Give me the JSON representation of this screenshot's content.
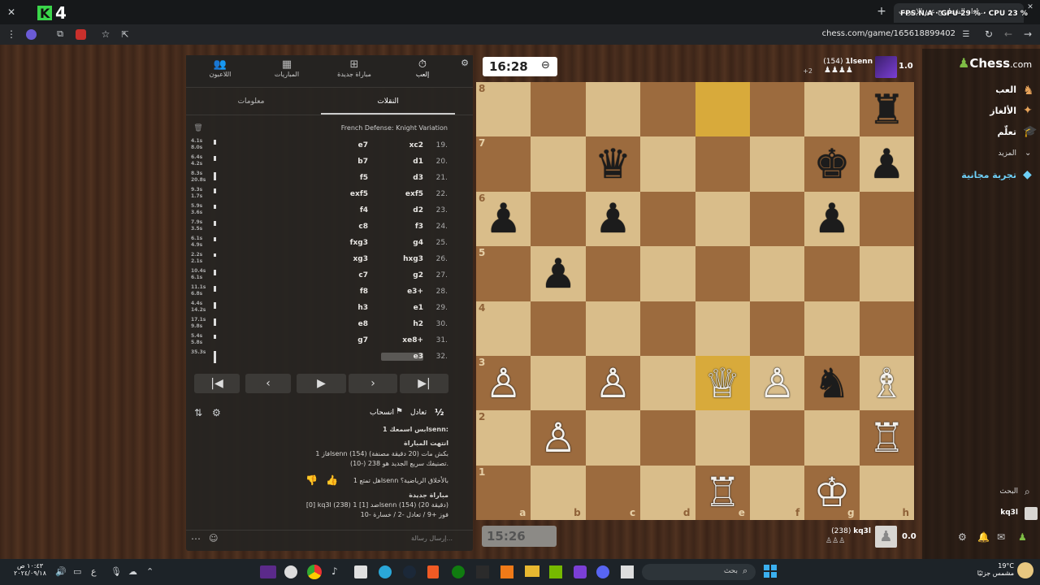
{
  "browser": {
    "close_label": "✕",
    "tab_title": "أداء الشطرنج عبر الإنترنت...",
    "fps_overlay": "FPS N/A · GPU 29 % · CPU 23 %",
    "url": "chess.com/game/165618899402",
    "new_tab": "+",
    "window_close": "✕"
  },
  "header_tabs": [
    {
      "label": "اللاعبون"
    },
    {
      "label": "المباريات"
    },
    {
      "label": "مباراة جديدة"
    },
    {
      "label": "إلعب"
    }
  ],
  "subtabs": {
    "info": "معلومات",
    "moves": "النقلات"
  },
  "opening": "French Defense: Knight Variation",
  "moves": [
    {
      "num": "19.",
      "white": "xc2",
      "black": "e7",
      "eval": "4.1s",
      "eval2": "8.0s",
      "fill": 0.3
    },
    {
      "num": "20.",
      "white": "d1",
      "black": "b7",
      "eval": "6.4s",
      "eval2": "4.2s",
      "fill": 0.25
    },
    {
      "num": "21.",
      "white": "d3",
      "black": "f5",
      "eval": "8.3s",
      "eval2": "20.8s",
      "fill": 0.6
    },
    {
      "num": "22.",
      "white": "exf5",
      "black": "exf5",
      "eval": "9.3s",
      "eval2": "1.7s",
      "fill": 0.3
    },
    {
      "num": "23.",
      "white": "d2",
      "black": "f4",
      "eval": "5.9s",
      "eval2": "3.6s",
      "fill": 0.2
    },
    {
      "num": "24.",
      "white": "f3",
      "black": "c8",
      "eval": "7.9s",
      "eval2": "3.5s",
      "fill": 0.25
    },
    {
      "num": "25.",
      "white": "g4",
      "black": "fxg3",
      "eval": "6.1s",
      "eval2": "4.9s",
      "fill": 0.2
    },
    {
      "num": "26.",
      "white": "hxg3",
      "black": "xg3",
      "eval": "2.2s",
      "eval2": "2.1s",
      "fill": 0.15
    },
    {
      "num": "27.",
      "white": "g2",
      "black": "c7",
      "eval": "10.4s",
      "eval2": "6.1s",
      "fill": 0.35
    },
    {
      "num": "28.",
      "white": "e3+",
      "black": "f8",
      "eval": "11.1s",
      "eval2": "6.8s",
      "fill": 0.35
    },
    {
      "num": "29.",
      "white": "e1",
      "black": "h3",
      "eval": "4.4s",
      "eval2": "14.2s",
      "fill": 0.4
    },
    {
      "num": "30.",
      "white": "h2",
      "black": "e8",
      "eval": "17.1s",
      "eval2": "9.8s",
      "fill": 0.5
    },
    {
      "num": "31.",
      "white": "xe8+",
      "black": "g7",
      "eval": "5.4s",
      "eval2": "5.8s",
      "fill": 0.2
    },
    {
      "num": "32.",
      "white": "e3",
      "black": "",
      "eval": "35.3s",
      "eval2": "",
      "fill": 0.9
    }
  ],
  "controls": {
    "first": "|◀",
    "prev": "‹",
    "play": "▶",
    "next": "›",
    "last": "▶|"
  },
  "actions": {
    "draw": "تعادل",
    "draw_symbol": "½",
    "resign": "انسحاب"
  },
  "chat": {
    "line1_user": "1lsenn:",
    "line1_text": "بس اسمعك",
    "over_title": "انتهت المباراة",
    "over_line1": "فاز 1lsenn (154) بكش مات (20 دقيقة مصنفة)",
    "over_line2": "تصنيفك سريع الجديد هو 238 (-10).",
    "question": "هل تمتع 1lsenn بالأخلاق الرياضية؟",
    "new_game": "مباراة جديدة",
    "ng_line1": "[0] kq3l (238) ضد [1] 1lsenn (154) (20 دقيقة)",
    "ng_line2": "فوز +9 / تعادل -2 / خسارة -10",
    "input_placeholder": "إرسال رسالة..."
  },
  "top_clock": "16:28",
  "bottom_clock": "15:26",
  "top_player": {
    "name": "1lsenn",
    "rating": "(154)",
    "score": "1.0",
    "material": "+2"
  },
  "bottom_player": {
    "name": "kq3l",
    "rating": "(238)",
    "score": "0.0"
  },
  "files": [
    "a",
    "b",
    "c",
    "d",
    "e",
    "f",
    "g",
    "h"
  ],
  "ranks": [
    "8",
    "7",
    "6",
    "5",
    "4",
    "3",
    "2",
    "1"
  ],
  "board": [
    [
      "",
      "",
      "",
      "",
      "",
      "",
      "",
      "♜"
    ],
    [
      "",
      "",
      "♛",
      "",
      "",
      "",
      "♚",
      "♟"
    ],
    [
      "♟",
      "",
      "♟",
      "",
      "",
      "",
      "♟",
      ""
    ],
    [
      "",
      "♟",
      "",
      "",
      "",
      "",
      "",
      ""
    ],
    [
      "",
      "",
      "",
      "",
      "",
      "",
      "",
      ""
    ],
    [
      "♙",
      "",
      "♙",
      "",
      "♕",
      "♙",
      "♞",
      "♗"
    ],
    [
      "",
      "♙",
      "",
      "",
      "",
      "",
      "",
      "♖"
    ],
    [
      "",
      "",
      "",
      "",
      "♖",
      "",
      "♔",
      ""
    ]
  ],
  "highlights": [
    [
      0,
      4
    ],
    [
      5,
      4
    ]
  ],
  "nav": {
    "logo": "Chess",
    "logo_suffix": ".com",
    "play": "العب",
    "puzzles": "الألغاز",
    "learn": "تعلّم",
    "more": "المزيد",
    "trial": "تجربة مجانية",
    "search": "البحث",
    "user": "kq3l"
  },
  "taskbar": {
    "time": "١٠:٤٣ ص",
    "date": "٢٠٢٤/٠٩/١٨",
    "weather_temp": "19°C",
    "weather_text": "مشمس جزئيًا",
    "search": "بحث",
    "lang": "ع"
  }
}
